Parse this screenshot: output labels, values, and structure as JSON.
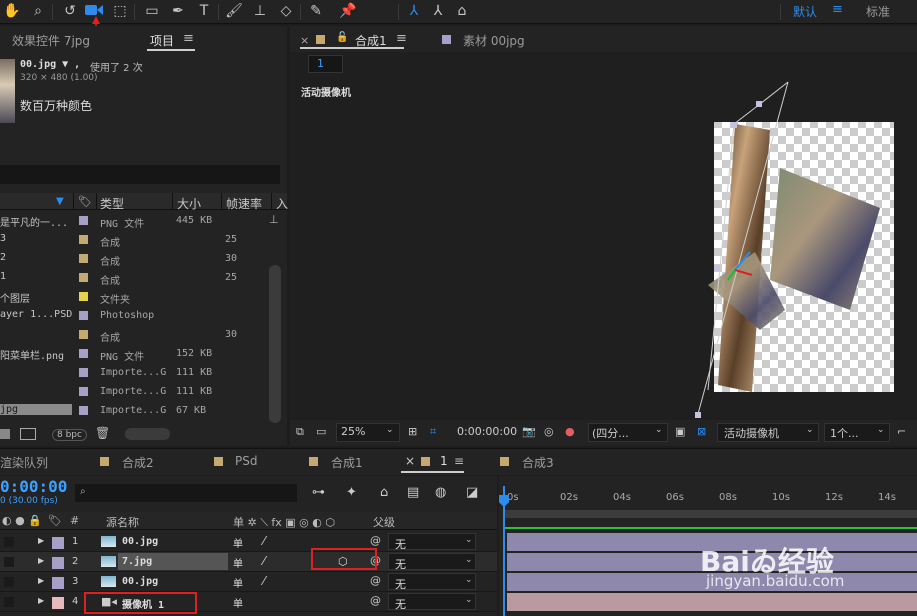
{
  "toolbar": {
    "workspace_default": "默认",
    "workspace_standard": "标准",
    "menu_icon": "≡"
  },
  "project_panel": {
    "tab_effects": "效果控件 7jpg",
    "tab_project": "项目",
    "tab_menu": "≡",
    "file_name": "00.jpg ▼ ,",
    "file_used": "使用了 2 次",
    "file_dims": "320 × 480 (1.00)",
    "file_colors": "数百万种颜色",
    "headers": {
      "type": "类型",
      "size": "大小",
      "fps": "帧速率",
      "in": "入"
    },
    "bpc": "8 bpc",
    "rows": [
      {
        "name": "是平凡的一...",
        "color": "#a89fc8",
        "type": "PNG 文件",
        "size": "445 KB",
        "fps": ""
      },
      {
        "name": "3",
        "color": "#c6a871",
        "type": "合成",
        "size": "",
        "fps": "25"
      },
      {
        "name": "2",
        "color": "#c6a871",
        "type": "合成",
        "size": "",
        "fps": "30"
      },
      {
        "name": "1",
        "color": "#c6a871",
        "type": "合成",
        "size": "",
        "fps": "25"
      },
      {
        "name": "个图层",
        "color": "#e6d34a",
        "type": "文件夹",
        "size": "",
        "fps": ""
      },
      {
        "name": "ayer 1...PSD",
        "color": "#a89fc8",
        "type": "Photoshop",
        "size": "",
        "fps": ""
      },
      {
        "name": "",
        "color": "#c6a871",
        "type": "合成",
        "size": "",
        "fps": "30"
      },
      {
        "name": "阳菜单栏.png",
        "color": "#a89fc8",
        "type": "PNG 文件",
        "size": "152 KB",
        "fps": ""
      },
      {
        "name": "",
        "color": "#a89fc8",
        "type": "Importe...G",
        "size": "111 KB",
        "fps": ""
      },
      {
        "name": "",
        "color": "#a89fc8",
        "type": "Importe...G",
        "size": "111 KB",
        "fps": ""
      },
      {
        "name": "jpg",
        "color": "#a89fc8",
        "type": "Importe...G",
        "size": "67 KB",
        "fps": "",
        "selected": true
      }
    ]
  },
  "viewer": {
    "tab_close": "×",
    "tab_comp": "合成1",
    "tab_menu": "≡",
    "tab_material": "素材 00jpg",
    "breadcrumb": "1",
    "camera_label": "活动摄像机",
    "zoom": "25%",
    "timecode": "0:00:00:00",
    "view_layout": "(四分...",
    "active_camera": "活动摄像机",
    "views": "1个...",
    "checker_light": "#ffffff",
    "checker_dark": "#cccccc"
  },
  "timeline": {
    "tabs": [
      {
        "label": "渲染队列",
        "color": ""
      },
      {
        "label": "合成2",
        "color": "#c6a871"
      },
      {
        "label": "PSd",
        "color": "#c6a871"
      },
      {
        "label": "合成1",
        "color": "#c6a871"
      },
      {
        "label": "1",
        "color": "#c6a871",
        "active": true,
        "close": "×",
        "menu": "≡"
      },
      {
        "label": "合成3",
        "color": "#c6a871"
      }
    ],
    "timecode": "0:00:00",
    "fps": "0 (30.00 fps)",
    "columns": {
      "num": "#",
      "source_name": "源名称",
      "parent": "父级"
    },
    "ticks": [
      "0s",
      "02s",
      "04s",
      "06s",
      "08s",
      "10s",
      "12s",
      "14s"
    ],
    "layers": [
      {
        "num": "1",
        "name": "00.jpg",
        "color": "#a89fc8",
        "type": "footage",
        "parent": "无",
        "bar_color": "#8e88ad"
      },
      {
        "num": "2",
        "name": "7.jpg",
        "color": "#a89fc8",
        "type": "footage",
        "parent": "无",
        "bar_color": "#8e88ad",
        "selected": true
      },
      {
        "num": "3",
        "name": "00.jpg",
        "color": "#a89fc8",
        "type": "footage",
        "parent": "无",
        "bar_color": "#8e88ad"
      },
      {
        "num": "4",
        "name": "摄像机 1",
        "color": "#e8b8bf",
        "type": "camera",
        "parent": "无",
        "bar_color": "#b89aa0"
      }
    ]
  },
  "watermark": {
    "brand": "Baiゐ经验",
    "url": "jingyan.baidu.com"
  }
}
